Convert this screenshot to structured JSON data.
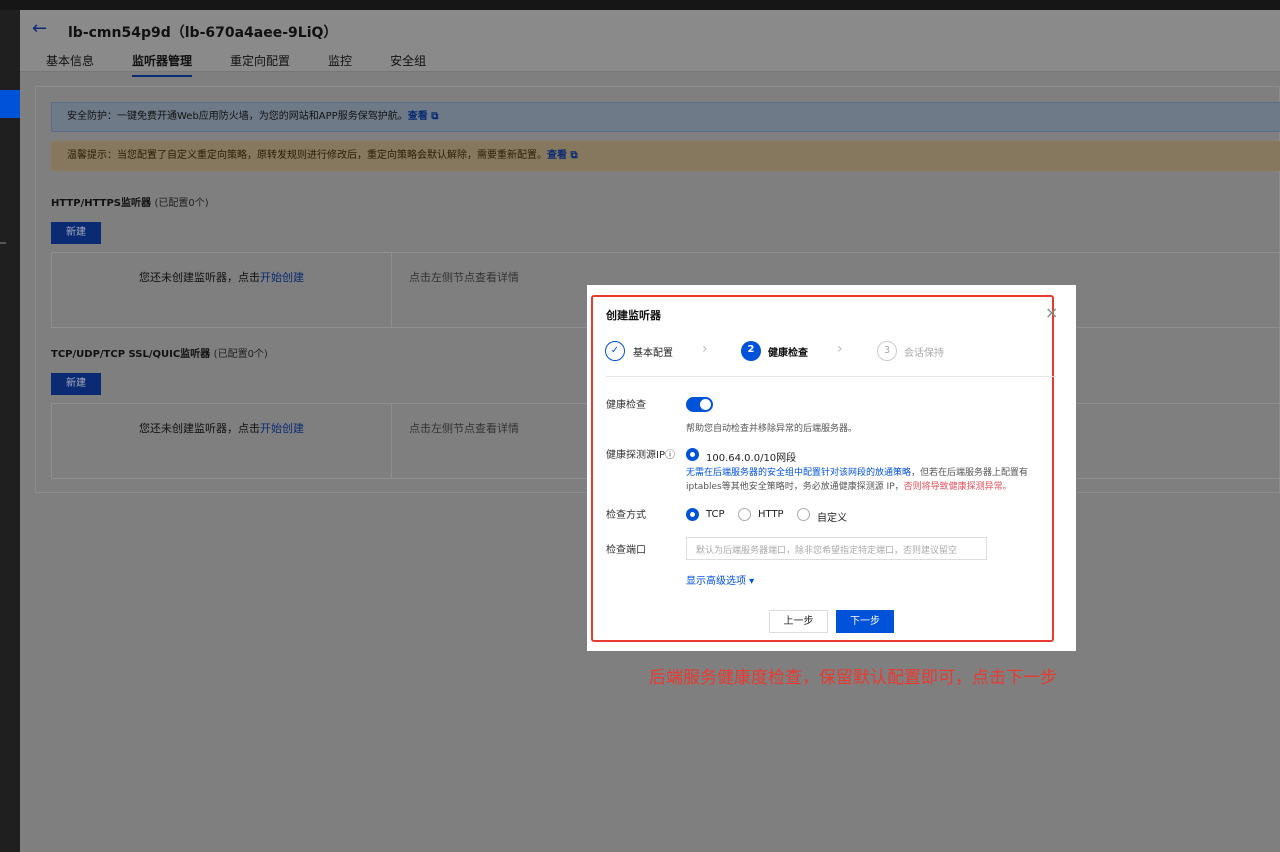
{
  "header": {
    "title": "lb-cmn54p9d（lb-670a4aee-9LiQ）",
    "tabs": [
      "基本信息",
      "监听器管理",
      "重定向配置",
      "监控",
      "安全组"
    ],
    "active_tab": "监听器管理"
  },
  "notices": {
    "security": {
      "text": "安全防护：一键免费开通Web应用防火墙，为您的网站和APP服务保驾护航。",
      "link": "查看"
    },
    "warning": {
      "text": "温馨提示：当您配置了自定义重定向策略，原转发规则进行修改后，重定向策略会默认解除，需要重新配置。",
      "link": "查看"
    }
  },
  "http_section": {
    "title": "HTTP/HTTPS监听器",
    "count": "(已配置0个)",
    "new_button": "新建",
    "empty_text": "您还未创建监听器，点击",
    "empty_link": "开始创建",
    "detail_hint": "点击左侧节点查看详情"
  },
  "tcp_section": {
    "title": "TCP/UDP/TCP SSL/QUIC监听器",
    "count": "(已配置0个)",
    "new_button": "新建",
    "empty_text": "您还未创建监听器，点击",
    "empty_link": "开始创建",
    "detail_hint": "点击左侧节点查看详情"
  },
  "modal": {
    "title": "创建监听器",
    "close": "×",
    "steps": [
      {
        "index": "✓",
        "label": "基本配置",
        "state": "done"
      },
      {
        "index": "2",
        "label": "健康检查",
        "state": "active"
      },
      {
        "index": "3",
        "label": "会话保持",
        "state": "pending"
      }
    ],
    "health_check": {
      "label": "健康检查",
      "enabled": true,
      "help": "帮助您自动检查并移除异常的后端服务器。"
    },
    "source_ip": {
      "label": "健康探测源IP",
      "info_icon": "ⓘ",
      "option": "100.64.0.0/10网段",
      "note_blue": "无需在后端服务器的安全组中配置针对该网段的放通策略",
      "note_gray1": "，但若在后端服务器上配置有",
      "note_gray2": "iptables等其他安全策略时，务必放通健康探测源 IP，",
      "note_red": "否则将导致健康探测异常。"
    },
    "method": {
      "label": "检查方式",
      "options": [
        "TCP",
        "HTTP",
        "自定义"
      ],
      "selected": "TCP"
    },
    "port": {
      "label": "检查端口",
      "placeholder": "默认为后端服务器端口，除非您希望指定特定端口，否则建议留空"
    },
    "advanced_link": "显示高级选项 ▾",
    "prev_button": "上一步",
    "next_button": "下一步"
  },
  "annotation": "后端服务健康度检查，保留默认配置即可，点击下一步",
  "colors": {
    "primary": "#0052d9",
    "annotation_red": "#e83a30",
    "overlay": "#7f7f7f"
  }
}
